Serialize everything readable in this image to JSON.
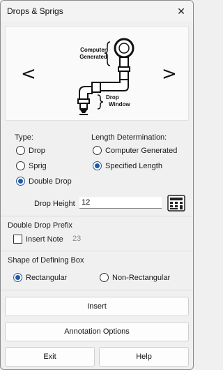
{
  "window": {
    "title": "Drops & Sprigs",
    "close_glyph": "✕"
  },
  "nav": {
    "prev": "<",
    "next": ">"
  },
  "diagram": {
    "label_top_line1": "Computer",
    "label_top_line2": "Generated",
    "label_bottom_line1": "Drop",
    "label_bottom_line2": "Window"
  },
  "type": {
    "label": "Type:",
    "options": [
      "Drop",
      "Sprig",
      "Double Drop"
    ],
    "selected": "Double Drop"
  },
  "length": {
    "label": "Length Determination:",
    "options": [
      "Computer Generated",
      "Specified Length"
    ],
    "selected": "Specified Length"
  },
  "drop_height": {
    "label": "Drop Height",
    "value": "12"
  },
  "prefix": {
    "label": "Double Drop Prefix",
    "insert_note": "Insert Note",
    "note_number": "23"
  },
  "shape": {
    "label": "Shape of Defining Box",
    "options": [
      "Rectangular",
      "Non-Rectangular"
    ],
    "selected": "Rectangular"
  },
  "buttons": {
    "insert": "Insert",
    "annotation": "Annotation Options",
    "exit": "Exit",
    "help": "Help"
  }
}
